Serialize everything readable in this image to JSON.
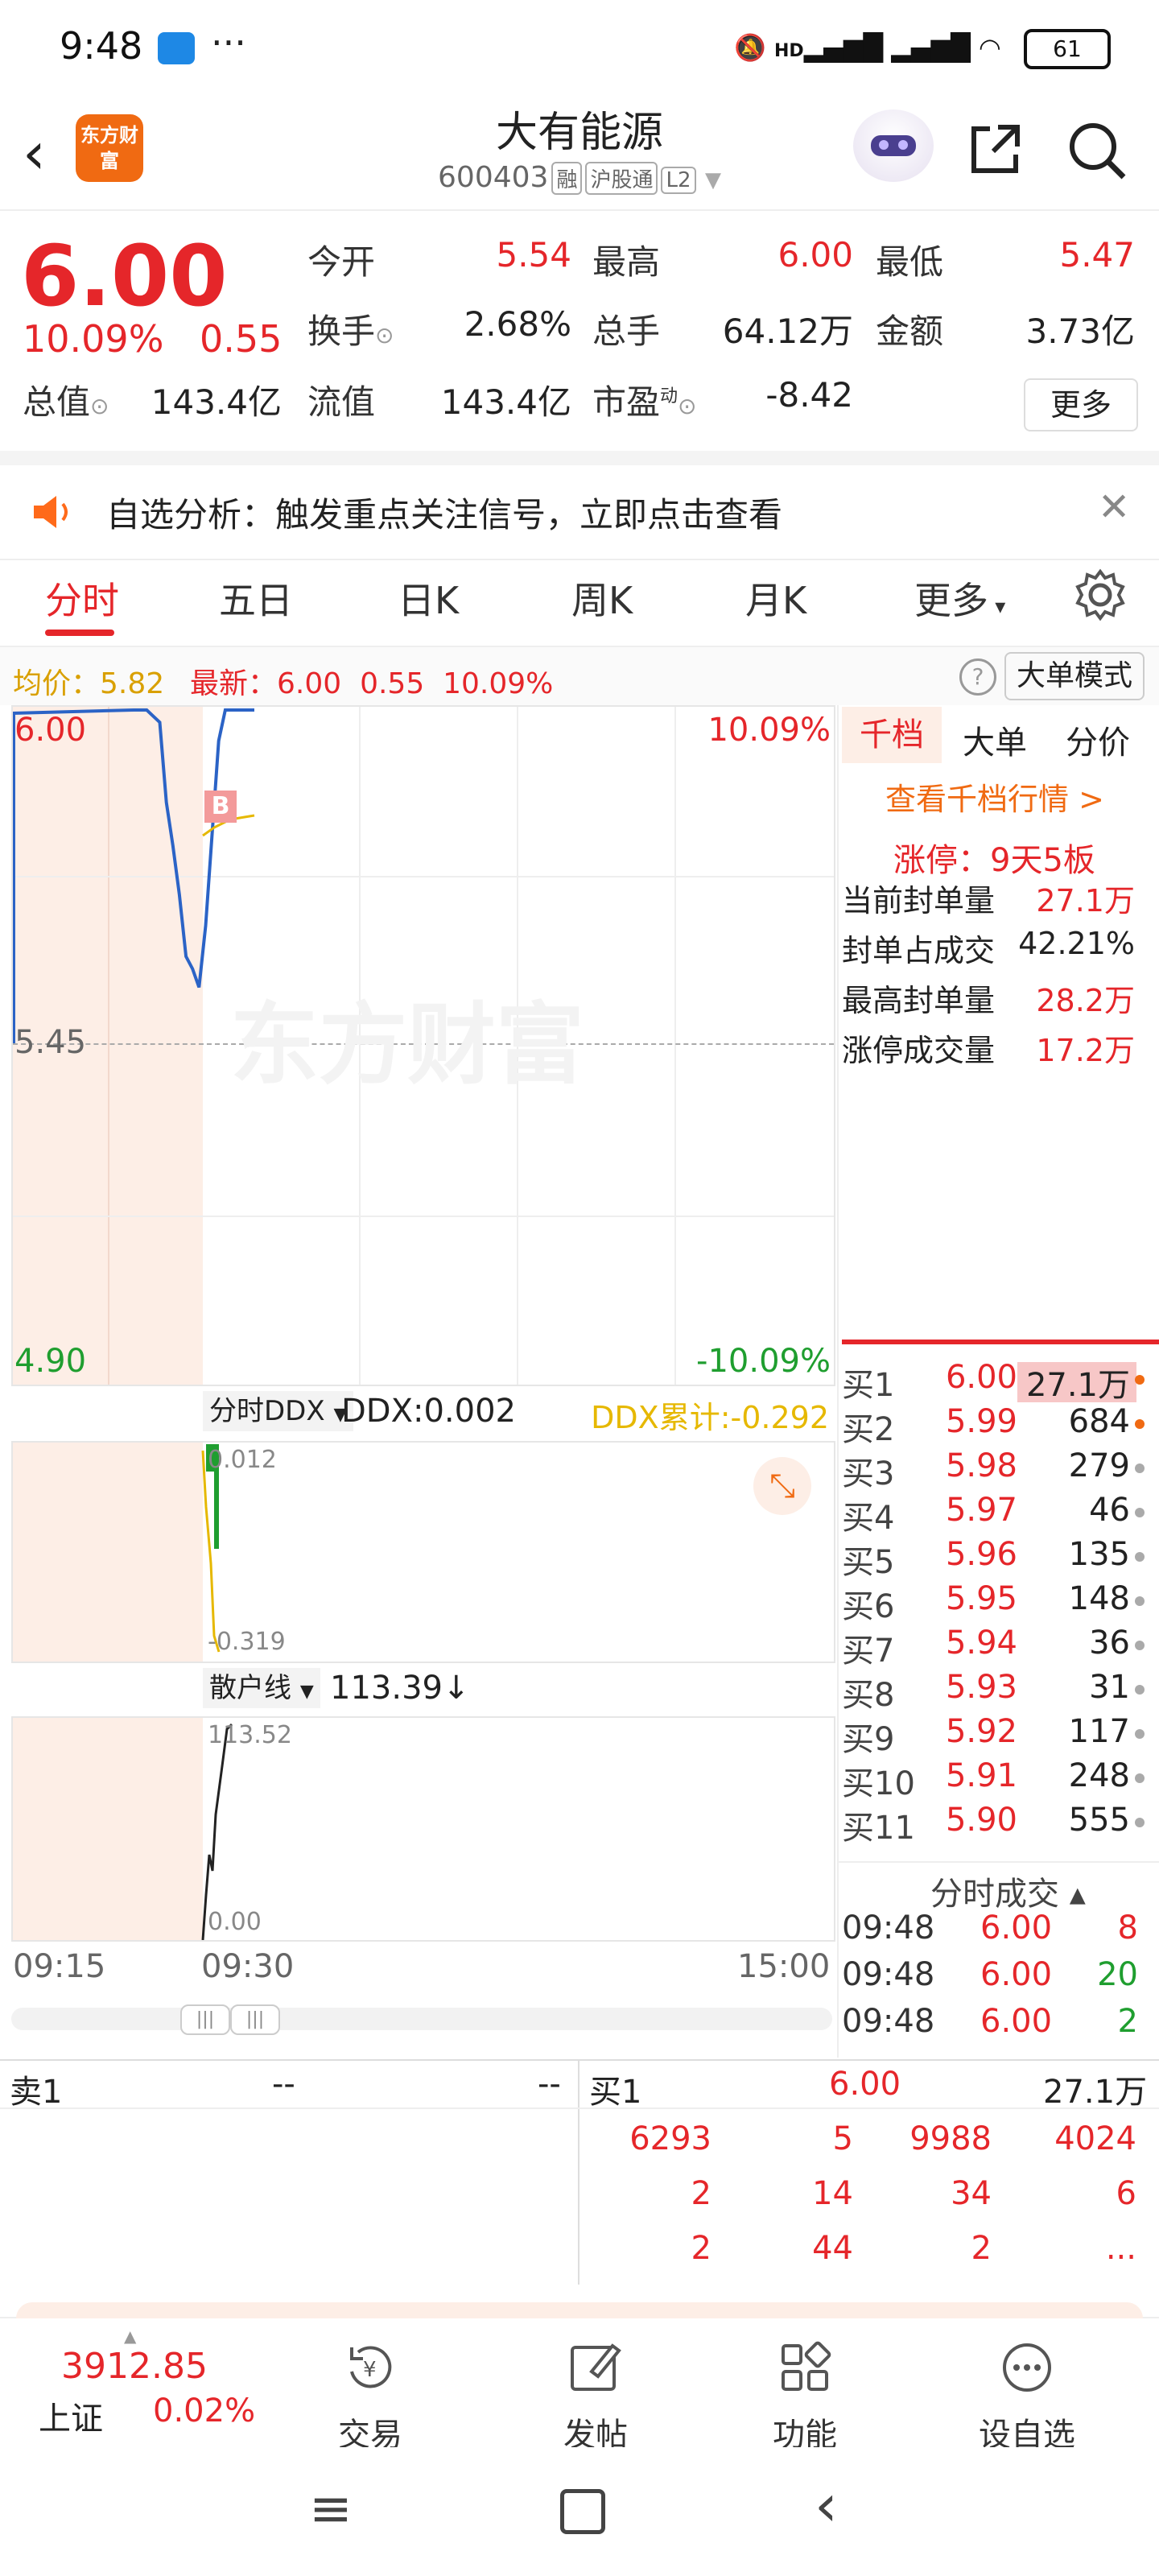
{
  "status": {
    "time": "9:48",
    "signal": "HD",
    "battery": "61"
  },
  "header": {
    "title": "大有能源",
    "code": "600403",
    "tags": [
      "融",
      "沪股通",
      "L2"
    ],
    "logo": "东方财富"
  },
  "quote": {
    "price": "6.00",
    "pct": "10.09%",
    "chg": "0.55",
    "fields": [
      {
        "label": "今开",
        "value": "5.54"
      },
      {
        "label": "最高",
        "value": "6.00"
      },
      {
        "label": "最低",
        "value": "5.47"
      },
      {
        "label": "换手",
        "value": "2.68%"
      },
      {
        "label": "总手",
        "value": "64.12万"
      },
      {
        "label": "金额",
        "value": "3.73亿"
      },
      {
        "label": "总值",
        "value": "143.4亿"
      },
      {
        "label": "流值",
        "value": "143.4亿"
      },
      {
        "label": "市盈",
        "value": "-8.42"
      }
    ],
    "pe_superscript": "动",
    "more_label": "更多"
  },
  "notice": {
    "text": "自选分析：触发重点关注信号，立即点击查看"
  },
  "tabs": [
    "分时",
    "五日",
    "日K",
    "周K",
    "月K",
    "更多"
  ],
  "infoline": {
    "avg_label": "均价：",
    "avg": "5.82",
    "latest_label": "最新：",
    "latest": "6.00",
    "chg": "0.55",
    "pct": "10.09%",
    "big_mode": "大单模式"
  },
  "chart": {
    "ytop": "6.00",
    "ymid": "5.45",
    "ybot": "4.90",
    "pct_top": "10.09%",
    "pct_bot": "-10.09%",
    "b_marker": "B",
    "watermark": "东方财富",
    "ddx": {
      "label": "分时DDX",
      "value": "DDX:0.002",
      "cum": "DDX累计:-0.292",
      "top": "0.012",
      "bottom": "-0.319"
    },
    "retail": {
      "label": "散户线",
      "value": "113.39",
      "top": "113.52",
      "bottom": "0.00"
    },
    "times": [
      "09:15",
      "09:30",
      "15:00"
    ],
    "line_data": [
      6.0,
      6.0,
      6.0,
      5.99,
      5.98,
      5.85,
      5.78,
      5.7,
      5.6,
      5.58,
      5.55,
      5.65,
      5.8,
      5.95,
      6.0,
      6.0
    ]
  },
  "orderbook": {
    "tabs": [
      "千档",
      "大单",
      "分价"
    ],
    "link": "查看千档行情 >",
    "limit_up": "涨停：9天5板",
    "stats": [
      {
        "label": "当前封单量",
        "value": "27.1万"
      },
      {
        "label": "封单占成交",
        "value": "42.21%"
      },
      {
        "label": "最高封单量",
        "value": "28.2万"
      },
      {
        "label": "涨停成交量",
        "value": "17.2万"
      }
    ],
    "bids": [
      {
        "label": "买1",
        "price": "6.00",
        "vol": "27.1万"
      },
      {
        "label": "买2",
        "price": "5.99",
        "vol": "684"
      },
      {
        "label": "买3",
        "price": "5.98",
        "vol": "279"
      },
      {
        "label": "买4",
        "price": "5.97",
        "vol": "46"
      },
      {
        "label": "买5",
        "price": "5.96",
        "vol": "135"
      },
      {
        "label": "买6",
        "price": "5.95",
        "vol": "148"
      },
      {
        "label": "买7",
        "price": "5.94",
        "vol": "36"
      },
      {
        "label": "买8",
        "price": "5.93",
        "vol": "31"
      },
      {
        "label": "买9",
        "price": "5.92",
        "vol": "117"
      },
      {
        "label": "买10",
        "price": "5.91",
        "vol": "248"
      },
      {
        "label": "买11",
        "price": "5.90",
        "vol": "555"
      }
    ],
    "trades_title": "分时成交",
    "trades": [
      {
        "time": "09:48",
        "price": "6.00",
        "vol": "8"
      },
      {
        "time": "09:48",
        "price": "6.00",
        "vol": "20"
      },
      {
        "time": "09:48",
        "price": "6.00",
        "vol": "2"
      }
    ]
  },
  "bottom_table": {
    "sell_label": "卖1",
    "sell_price": "--",
    "sell_vol": "--",
    "buy_label": "买1",
    "buy_price": "6.00",
    "buy_vol": "27.1万",
    "rows": [
      [
        "6293",
        "5",
        "9988",
        "4024"
      ],
      [
        "2",
        "14",
        "34",
        "6"
      ],
      [
        "2",
        "44",
        "2",
        "..."
      ]
    ]
  },
  "bottomnav": {
    "index_value": "3912.85",
    "index_name": "上证",
    "index_pct": "0.02%",
    "items": [
      "交易",
      "发帖",
      "功能",
      "设自选"
    ]
  }
}
